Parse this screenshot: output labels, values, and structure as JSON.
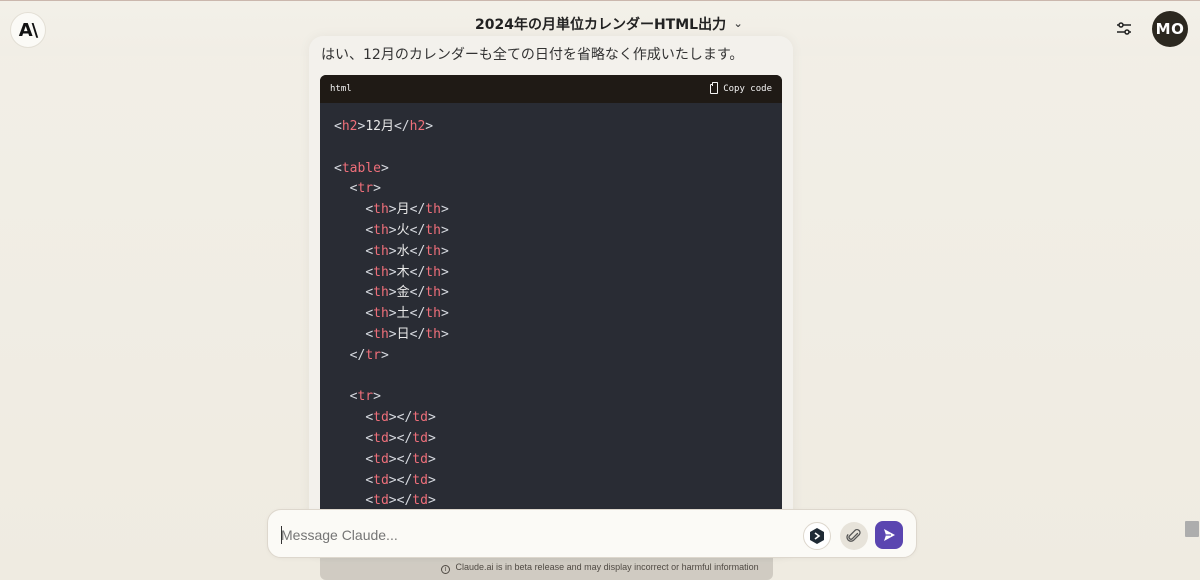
{
  "header": {
    "logo_text": "A\\",
    "title": "2024年の月単位カレンダーHTML出力",
    "avatar_initials": "MO"
  },
  "message": {
    "text": "はい、12月のカレンダーも全ての日付を省略なく作成いたします。"
  },
  "code_block": {
    "language": "html",
    "copy_label": "Copy code",
    "lines": [
      {
        "indent": "",
        "parts": [
          [
            "punct",
            "<"
          ],
          [
            "tag",
            "h2"
          ],
          [
            "punct",
            ">"
          ],
          [
            "text",
            "12月"
          ],
          [
            "punct",
            "</"
          ],
          [
            "tag",
            "h2"
          ],
          [
            "punct",
            ">"
          ]
        ]
      },
      {
        "indent": "",
        "parts": []
      },
      {
        "indent": "",
        "parts": [
          [
            "punct",
            "<"
          ],
          [
            "tag",
            "table"
          ],
          [
            "punct",
            ">"
          ]
        ]
      },
      {
        "indent": "  ",
        "parts": [
          [
            "punct",
            "<"
          ],
          [
            "tag",
            "tr"
          ],
          [
            "punct",
            ">"
          ]
        ]
      },
      {
        "indent": "    ",
        "parts": [
          [
            "punct",
            "<"
          ],
          [
            "tag",
            "th"
          ],
          [
            "punct",
            ">"
          ],
          [
            "text",
            "月"
          ],
          [
            "punct",
            "</"
          ],
          [
            "tag",
            "th"
          ],
          [
            "punct",
            ">"
          ]
        ]
      },
      {
        "indent": "    ",
        "parts": [
          [
            "punct",
            "<"
          ],
          [
            "tag",
            "th"
          ],
          [
            "punct",
            ">"
          ],
          [
            "text",
            "火"
          ],
          [
            "punct",
            "</"
          ],
          [
            "tag",
            "th"
          ],
          [
            "punct",
            ">"
          ]
        ]
      },
      {
        "indent": "    ",
        "parts": [
          [
            "punct",
            "<"
          ],
          [
            "tag",
            "th"
          ],
          [
            "punct",
            ">"
          ],
          [
            "text",
            "水"
          ],
          [
            "punct",
            "</"
          ],
          [
            "tag",
            "th"
          ],
          [
            "punct",
            ">"
          ]
        ]
      },
      {
        "indent": "    ",
        "parts": [
          [
            "punct",
            "<"
          ],
          [
            "tag",
            "th"
          ],
          [
            "punct",
            ">"
          ],
          [
            "text",
            "木"
          ],
          [
            "punct",
            "</"
          ],
          [
            "tag",
            "th"
          ],
          [
            "punct",
            ">"
          ]
        ]
      },
      {
        "indent": "    ",
        "parts": [
          [
            "punct",
            "<"
          ],
          [
            "tag",
            "th"
          ],
          [
            "punct",
            ">"
          ],
          [
            "text",
            "金"
          ],
          [
            "punct",
            "</"
          ],
          [
            "tag",
            "th"
          ],
          [
            "punct",
            ">"
          ]
        ]
      },
      {
        "indent": "    ",
        "parts": [
          [
            "punct",
            "<"
          ],
          [
            "tag",
            "th"
          ],
          [
            "punct",
            ">"
          ],
          [
            "text",
            "土"
          ],
          [
            "punct",
            "</"
          ],
          [
            "tag",
            "th"
          ],
          [
            "punct",
            ">"
          ]
        ]
      },
      {
        "indent": "    ",
        "parts": [
          [
            "punct",
            "<"
          ],
          [
            "tag",
            "th"
          ],
          [
            "punct",
            ">"
          ],
          [
            "text",
            "日"
          ],
          [
            "punct",
            "</"
          ],
          [
            "tag",
            "th"
          ],
          [
            "punct",
            ">"
          ]
        ]
      },
      {
        "indent": "  ",
        "parts": [
          [
            "punct",
            "</"
          ],
          [
            "tag",
            "tr"
          ],
          [
            "punct",
            ">"
          ]
        ]
      },
      {
        "indent": "",
        "parts": []
      },
      {
        "indent": "  ",
        "parts": [
          [
            "punct",
            "<"
          ],
          [
            "tag",
            "tr"
          ],
          [
            "punct",
            ">"
          ]
        ]
      },
      {
        "indent": "    ",
        "parts": [
          [
            "punct",
            "<"
          ],
          [
            "tag",
            "td"
          ],
          [
            "punct",
            "></"
          ],
          [
            "tag",
            "td"
          ],
          [
            "punct",
            ">"
          ]
        ]
      },
      {
        "indent": "    ",
        "parts": [
          [
            "punct",
            "<"
          ],
          [
            "tag",
            "td"
          ],
          [
            "punct",
            "></"
          ],
          [
            "tag",
            "td"
          ],
          [
            "punct",
            ">"
          ]
        ]
      },
      {
        "indent": "    ",
        "parts": [
          [
            "punct",
            "<"
          ],
          [
            "tag",
            "td"
          ],
          [
            "punct",
            "></"
          ],
          [
            "tag",
            "td"
          ],
          [
            "punct",
            ">"
          ]
        ]
      },
      {
        "indent": "    ",
        "parts": [
          [
            "punct",
            "<"
          ],
          [
            "tag",
            "td"
          ],
          [
            "punct",
            "></"
          ],
          [
            "tag",
            "td"
          ],
          [
            "punct",
            ">"
          ]
        ]
      },
      {
        "indent": "    ",
        "parts": [
          [
            "punct",
            "<"
          ],
          [
            "tag",
            "td"
          ],
          [
            "punct",
            "></"
          ],
          [
            "tag",
            "td"
          ],
          [
            "punct",
            ">"
          ]
        ]
      }
    ]
  },
  "composer": {
    "placeholder": "Message Claude..."
  },
  "footer": {
    "info_symbol": "i",
    "disclaimer": "Claude.ai is in beta release and may display incorrect or harmful information"
  },
  "icons": {
    "settings": "settings-sliders-icon",
    "extension": "extension-icon",
    "attach": "paperclip-icon",
    "send": "send-arrow-icon",
    "copy": "clipboard-icon",
    "dropdown": "chevron-down-icon"
  },
  "colors": {
    "background": "#f0ede4",
    "code_background": "#292c34",
    "code_header": "#1f1a15",
    "tag": "#ef6f7a",
    "avatar": "#2c2820",
    "send_button": "#5a45b0"
  }
}
